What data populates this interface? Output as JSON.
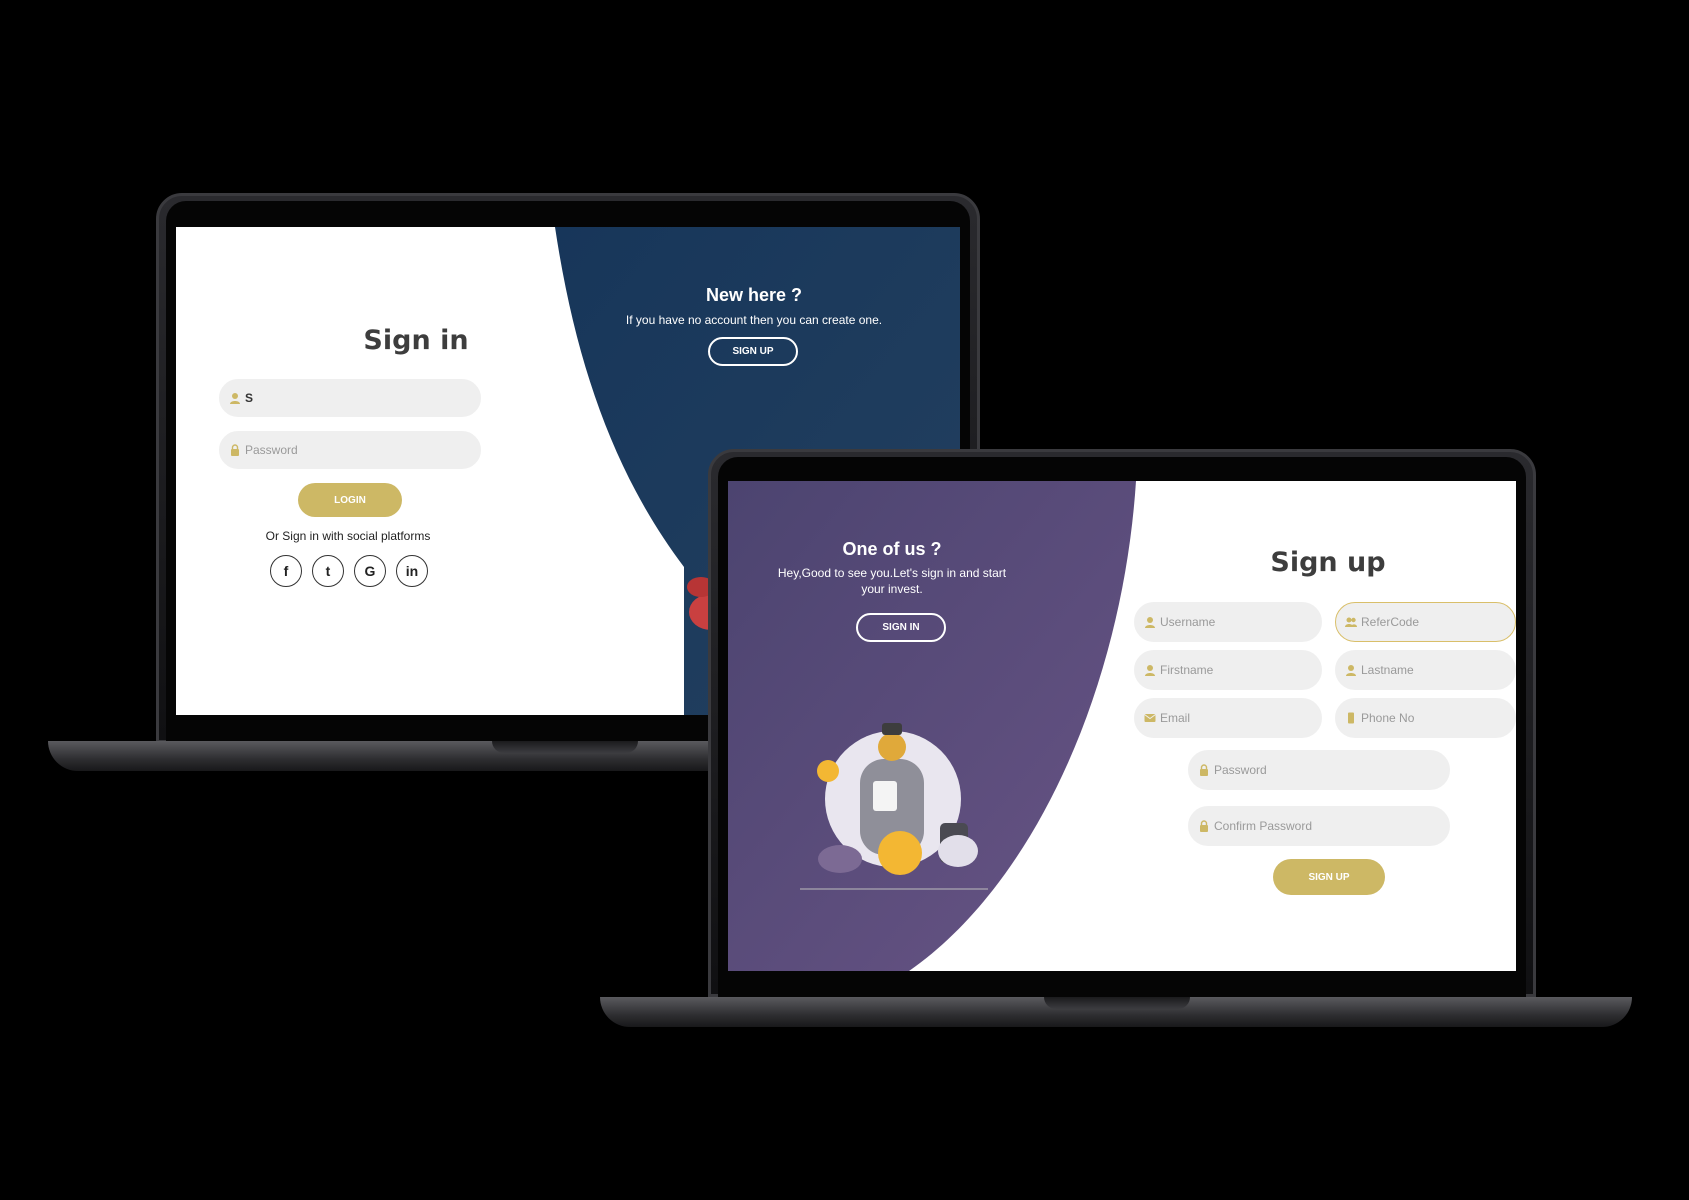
{
  "signin_screen": {
    "title": "Sign in",
    "username_value": "S",
    "password_placeholder": "Password",
    "login_label": "LOGIN",
    "social_text": "Or Sign in with social platforms",
    "social_icons": [
      "facebook-icon",
      "twitter-icon",
      "google-icon",
      "linkedin-icon"
    ],
    "social_glyphs": [
      "f",
      "t",
      "G",
      "in"
    ],
    "panel_heading": "New here ?",
    "panel_text": "If you have no account then you can create one.",
    "panel_button": "SIGN UP",
    "panel_color": "#1d3a5c"
  },
  "signup_screen": {
    "panel_heading": "One of us ?",
    "panel_text": "Hey,Good to see you.Let's sign in and start your invest.",
    "panel_button": "SIGN IN",
    "panel_color": "#584a78",
    "title": "Sign up",
    "fields": {
      "username": "Username",
      "refer_code": "ReferCode",
      "firstname": "Firstname",
      "lastname": "Lastname",
      "email": "Email",
      "phone": "Phone No",
      "password": "Password",
      "confirm_password": "Confirm Password"
    },
    "submit_label": "SIGN UP"
  },
  "colors": {
    "accent_gold": "#cdb865",
    "input_bg": "#efefef",
    "title_text": "#3d3d3d"
  }
}
